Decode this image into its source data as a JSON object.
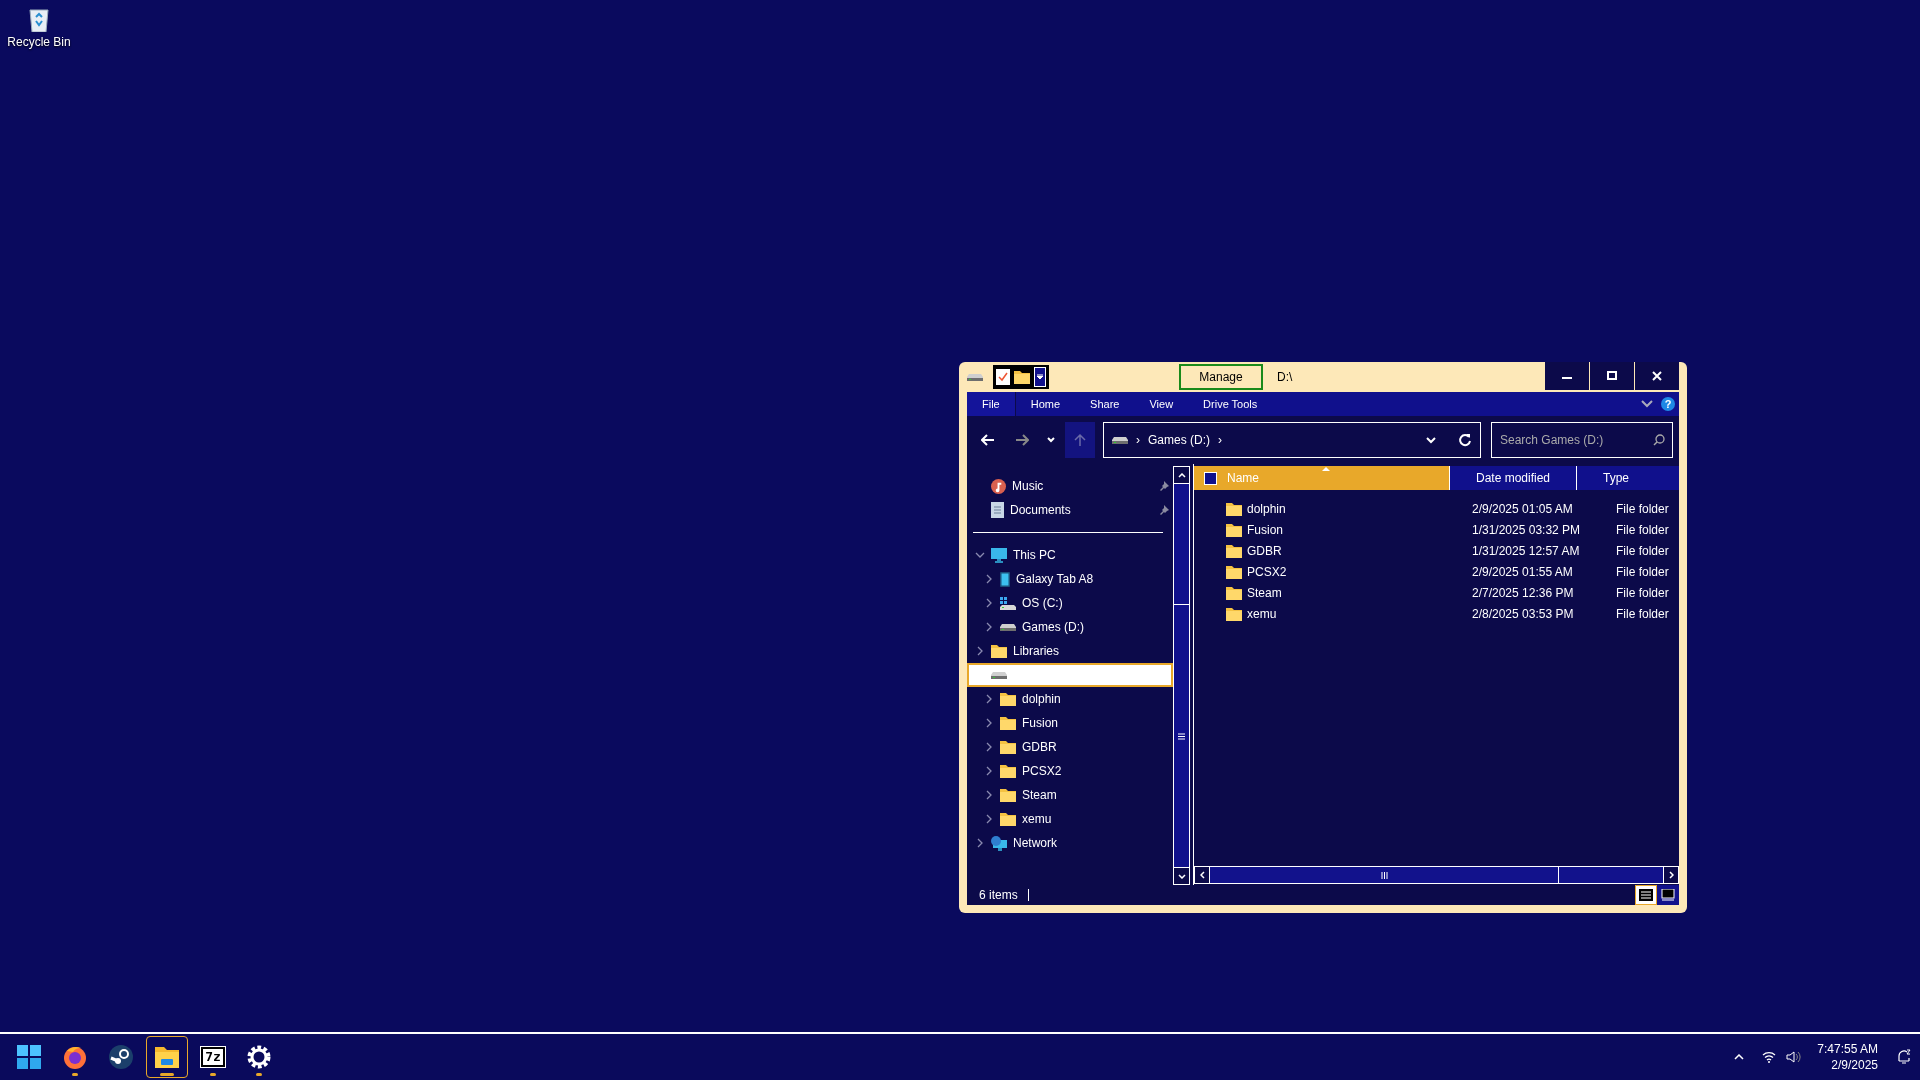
{
  "desktop_icons": [
    {
      "label": "Recycle Bin",
      "kind": "recycle-bin"
    }
  ],
  "window": {
    "title": "D:\\",
    "contextual_tab": "Manage",
    "ribbon_tabs": [
      {
        "label": "File",
        "kind": "file"
      },
      {
        "label": "Home",
        "kind": "tab"
      },
      {
        "label": "Share",
        "kind": "tab"
      },
      {
        "label": "View",
        "kind": "tab"
      },
      {
        "label": "Drive Tools",
        "kind": "tab"
      }
    ],
    "help_glyph": "?",
    "address": {
      "separator": "›",
      "crumbs": [
        "Games (D:)"
      ]
    },
    "search": {
      "placeholder": "Search Games (D:)"
    },
    "quick_access": [
      {
        "label": "Music",
        "kind": "music",
        "pinned": true
      },
      {
        "label": "Documents",
        "kind": "documents",
        "pinned": true
      }
    ],
    "tree": [
      {
        "label": "This PC",
        "kind": "pc",
        "expanded": true,
        "selected": false,
        "children": [
          {
            "label": "Galaxy Tab A8",
            "kind": "tablet",
            "expanded": false,
            "selected": false
          },
          {
            "label": "OS (C:)",
            "kind": "os-drive",
            "expanded": false,
            "selected": false
          },
          {
            "label": "Games (D:)",
            "kind": "drive",
            "expanded": false,
            "selected": false
          }
        ]
      },
      {
        "label": "Libraries",
        "kind": "folder",
        "expanded": false,
        "selected": false
      },
      {
        "kind": "drive",
        "selected": true,
        "children": [
          {
            "label": "dolphin",
            "kind": "folder",
            "expanded": false,
            "selected": false
          },
          {
            "label": "Fusion",
            "kind": "folder",
            "expanded": false,
            "selected": false
          },
          {
            "label": "GDBR",
            "kind": "folder",
            "expanded": false,
            "selected": false
          },
          {
            "label": "PCSX2",
            "kind": "folder",
            "expanded": false,
            "selected": false
          },
          {
            "label": "Steam",
            "kind": "folder",
            "expanded": false,
            "selected": false
          },
          {
            "label": "xemu",
            "kind": "folder",
            "expanded": false,
            "selected": false
          }
        ]
      },
      {
        "label": "Network",
        "kind": "network",
        "expanded": false,
        "selected": false
      }
    ],
    "columns": [
      {
        "label": "Name",
        "highlighted": true,
        "sorted": true
      },
      {
        "label": "Date modified",
        "highlighted": false,
        "sorted": false
      },
      {
        "label": "Type",
        "highlighted": false,
        "sorted": false
      }
    ],
    "files": [
      {
        "name": "dolphin",
        "date": "2/9/2025 01:05 AM",
        "type": "File folder"
      },
      {
        "name": "Fusion",
        "date": "1/31/2025 03:32 PM",
        "type": "File folder"
      },
      {
        "name": "GDBR",
        "date": "1/31/2025 12:57 AM",
        "type": "File folder"
      },
      {
        "name": "PCSX2",
        "date": "2/9/2025 01:55 AM",
        "type": "File folder"
      },
      {
        "name": "Steam",
        "date": "2/7/2025 12:36 PM",
        "type": "File folder"
      },
      {
        "name": "xemu",
        "date": "2/8/2025 03:53 PM",
        "type": "File folder"
      }
    ],
    "status_bar": {
      "item_count": "6 items"
    },
    "views": [
      {
        "kind": "details",
        "selected": true
      },
      {
        "kind": "large-icons",
        "selected": false
      }
    ]
  },
  "taskbar": {
    "apps": [
      {
        "kind": "start",
        "running": false,
        "active": false
      },
      {
        "kind": "firefox",
        "running": true,
        "active": false
      },
      {
        "kind": "steam",
        "running": false,
        "active": false
      },
      {
        "kind": "explorer",
        "running": true,
        "active": true
      },
      {
        "kind": "archiver",
        "logo_text": "7z",
        "running": true,
        "active": false
      },
      {
        "kind": "settings",
        "running": true,
        "active": false
      }
    ],
    "clock": {
      "time": "7:47:55 AM",
      "date": "2/9/2025"
    }
  }
}
